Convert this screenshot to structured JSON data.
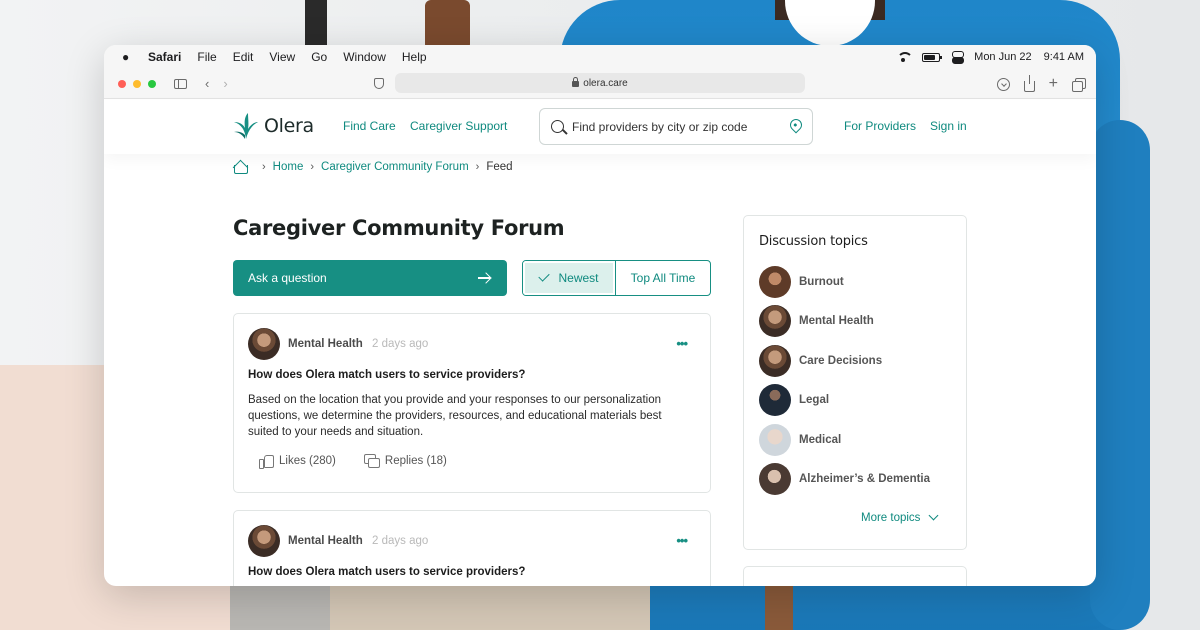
{
  "menubar": {
    "app": "Safari",
    "items": [
      "File",
      "Edit",
      "View",
      "Go",
      "Window",
      "Help"
    ],
    "date": "Mon Jun 22",
    "time": "9:41 AM"
  },
  "browser": {
    "url": "olera.care"
  },
  "header": {
    "brand": "Olera",
    "nav_find_care": "Find Care",
    "nav_caregiver_support": "Caregiver Support",
    "search_placeholder": "Find providers by city or zip code",
    "nav_for_providers": "For Providers",
    "nav_sign_in": "Sign in"
  },
  "breadcrumb": {
    "home": "Home",
    "forum": "Caregiver Community Forum",
    "current": "Feed"
  },
  "main": {
    "title": "Caregiver Community Forum",
    "ask_label": "Ask a question",
    "sort_newest": "Newest",
    "sort_top": "Top All Time",
    "posts": [
      {
        "topic": "Mental Health",
        "time": "2 days ago",
        "question": "How does Olera match users to service providers?",
        "body": "Based on the location that you provide and your responses to our personalization questions, we determine the providers, resources, and educational materials best suited to your needs and situation.",
        "likes": "Likes (280)",
        "replies": "Replies (18)"
      },
      {
        "topic": "Mental Health",
        "time": "2 days ago",
        "question": "How does Olera match users to service providers?"
      }
    ]
  },
  "sidebar": {
    "title": "Discussion topics",
    "topics": [
      {
        "label": "Burnout"
      },
      {
        "label": "Mental Health"
      },
      {
        "label": "Care Decisions"
      },
      {
        "label": "Legal"
      },
      {
        "label": "Medical"
      },
      {
        "label": "Alzheimer’s & Dementia"
      }
    ],
    "more_label": "More topics"
  },
  "colors": {
    "brand_teal": "#178f83",
    "link_teal": "#0f8a7f"
  }
}
